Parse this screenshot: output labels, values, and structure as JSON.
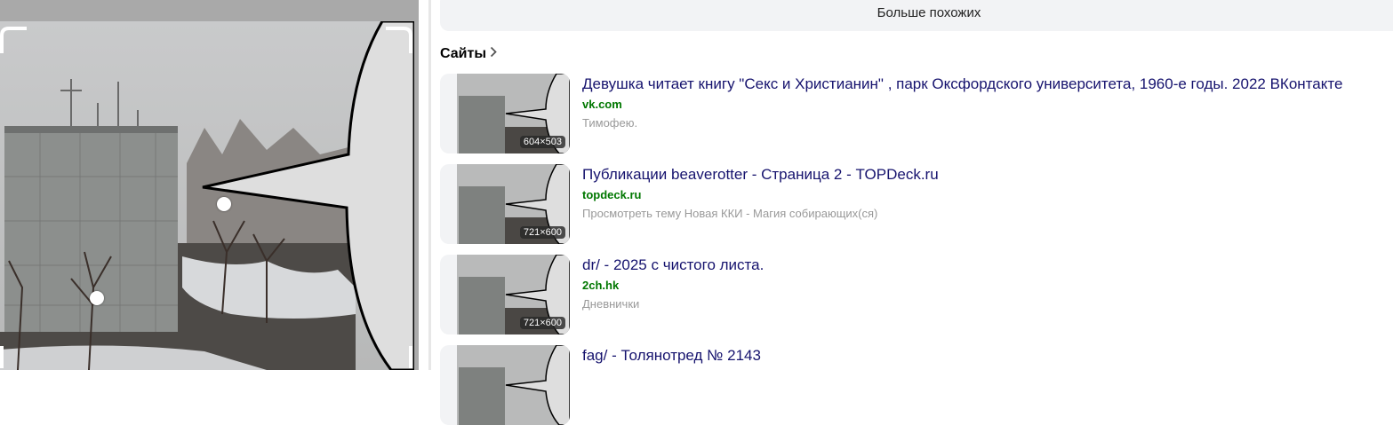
{
  "more_similar": {
    "label": "Больше похожих"
  },
  "sites": {
    "heading": "Сайты"
  },
  "results": [
    {
      "title": "Девушка читает книгу \"Секс и Христианин\" , парк Оксфордского университета, 1960-е годы. 2022 ВКонтакте",
      "domain": "vk.com",
      "snippet": "Тимофею.",
      "size": "604×503"
    },
    {
      "title": "Публикации beaverotter - Страница 2 - TOPDeck.ru",
      "domain": "topdeck.ru",
      "snippet": "Просмотреть тему Новая ККИ - Магия собирающих(ся)",
      "size": "721×600"
    },
    {
      "title": "dr/ - 2025 с чистого листа.",
      "domain": "2ch.hk",
      "snippet": "Дневнички",
      "size": "721×600"
    },
    {
      "title": "fag/ - Толянотред № 2143",
      "domain": "",
      "snippet": "",
      "size": ""
    }
  ],
  "colors": {
    "link": "#16136e",
    "domain": "#007700",
    "snippet": "#999999",
    "panel_bg": "#f2f3f5"
  },
  "icons": {
    "sites_chevron": "chevron-right-icon"
  }
}
